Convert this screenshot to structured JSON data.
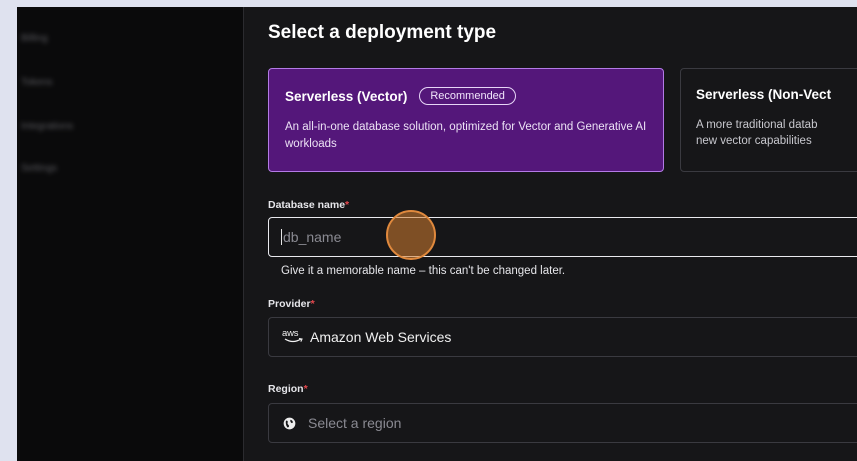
{
  "sidebar": {
    "items": [
      {
        "label": "Billing"
      },
      {
        "label": "Tokens"
      },
      {
        "label": "Integrations"
      },
      {
        "label": "Settings"
      }
    ]
  },
  "deployment": {
    "title": "Select a deployment type",
    "options": [
      {
        "title": "Serverless (Vector)",
        "badge": "Recommended",
        "description": "An all-in-one database solution, optimized for Vector and Generative AI workloads",
        "selected": true
      },
      {
        "title": "Serverless (Non-Vect",
        "line1": "A more traditional datab",
        "line2": "new vector capabilities",
        "selected": false
      }
    ]
  },
  "database_name": {
    "label": "Database name",
    "required_mark": "*",
    "placeholder": "db_name",
    "value": "",
    "hint": "Give it a memorable name – this can't be changed later."
  },
  "provider": {
    "label": "Provider",
    "required_mark": "*",
    "logo_text": "aws",
    "value": "Amazon Web Services"
  },
  "region": {
    "label": "Region",
    "required_mark": "*",
    "placeholder": "Select a region"
  },
  "colors": {
    "selected_card_bg": "#54177a",
    "selected_card_border": "#b37ae6",
    "required": "#e5484d",
    "app_bg": "#161618",
    "sidebar_bg": "#0a0a0b"
  }
}
